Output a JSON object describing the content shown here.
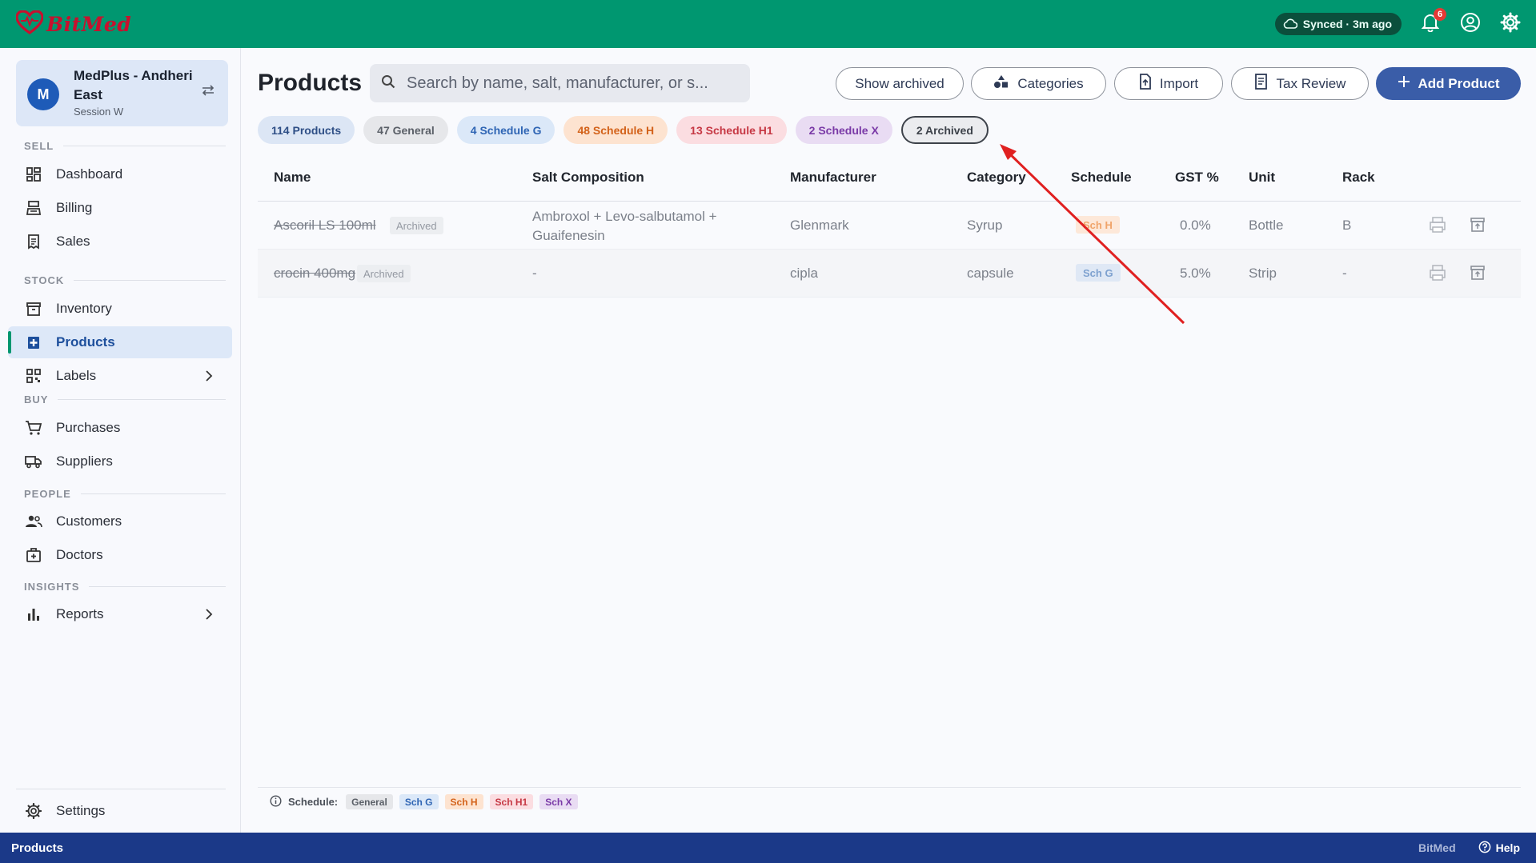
{
  "app": {
    "brand": "BitMed"
  },
  "topbar": {
    "sync_status": "Synced · 3m ago",
    "notification_count": "6"
  },
  "store": {
    "avatar_letter": "M",
    "name": "MedPlus - Andheri East",
    "session": "Session W"
  },
  "sidebar": {
    "sections": {
      "sell": "SELL",
      "stock": "STOCK",
      "buy": "BUY",
      "people": "PEOPLE",
      "insights": "INSIGHTS"
    },
    "items": {
      "dashboard": "Dashboard",
      "billing": "Billing",
      "sales": "Sales",
      "inventory": "Inventory",
      "products": "Products",
      "labels": "Labels",
      "purchases": "Purchases",
      "suppliers": "Suppliers",
      "customers": "Customers",
      "doctors": "Doctors",
      "reports": "Reports",
      "settings": "Settings"
    }
  },
  "page": {
    "title": "Products",
    "search_placeholder": "Search by name, salt, manufacturer, or s...",
    "buttons": {
      "show_archived": "Show archived",
      "categories": "Categories",
      "import": "Import",
      "tax_review": "Tax Review",
      "add_product": "Add Product"
    }
  },
  "chips": {
    "products": "114 Products",
    "general": "47 General",
    "schedule_g": "4 Schedule G",
    "schedule_h": "48 Schedule H",
    "schedule_h1": "13 Schedule H1",
    "schedule_x": "2 Schedule X",
    "archived": "2 Archived"
  },
  "table": {
    "headers": {
      "name": "Name",
      "salt": "Salt Composition",
      "manufacturer": "Manufacturer",
      "category": "Category",
      "schedule": "Schedule",
      "gst": "GST %",
      "unit": "Unit",
      "rack": "Rack"
    },
    "rows": [
      {
        "name": "Ascoril LS 100ml",
        "status": "Archived",
        "salt": "Ambroxol + Levo-salbutamol + Guaifenesin",
        "manufacturer": "Glenmark",
        "category": "Syrup",
        "schedule": "Sch H",
        "gst": "0.0%",
        "unit": "Bottle",
        "rack": "B"
      },
      {
        "name": "crocin 400mg",
        "status": "Archived",
        "salt": "-",
        "manufacturer": "cipla",
        "category": "capsule",
        "schedule": "Sch G",
        "gst": "5.0%",
        "unit": "Strip",
        "rack": "-"
      }
    ]
  },
  "legend": {
    "label": "Schedule:",
    "tags": [
      "General",
      "Sch G",
      "Sch H",
      "Sch H1",
      "Sch X"
    ]
  },
  "statusbar": {
    "current_page": "Products",
    "brand": "BitMed",
    "help": "Help"
  },
  "colors": {
    "topbar": "#009770",
    "primary": "#3a5da8",
    "statusbar": "#1b3988",
    "annotation_arrow": "#e02020"
  }
}
